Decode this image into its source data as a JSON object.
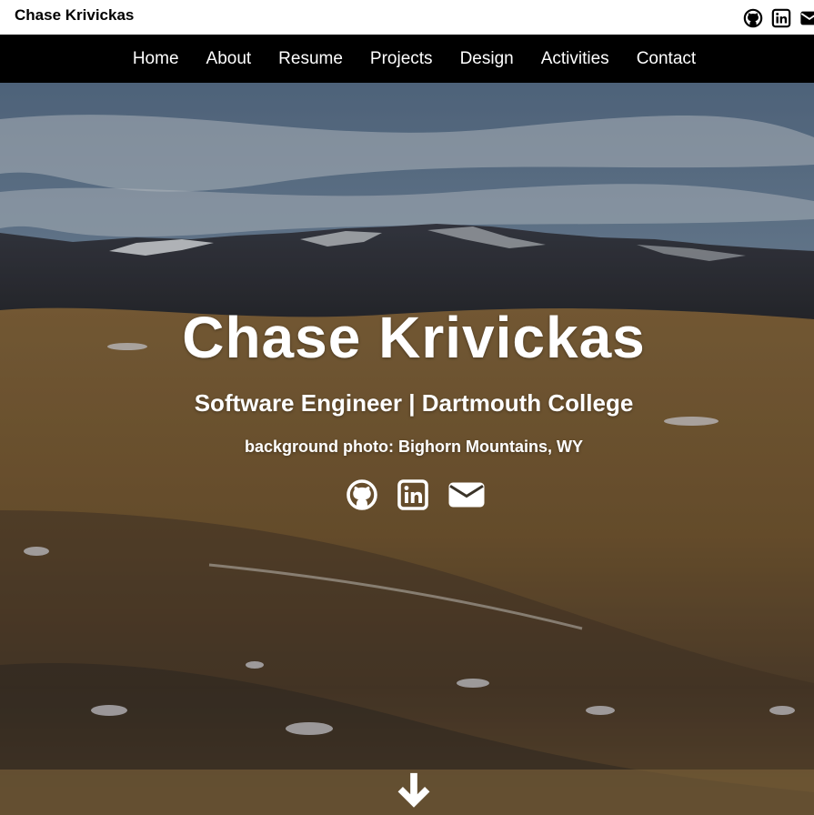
{
  "header": {
    "site_name": "Chase Krivickas",
    "icons": [
      "github-icon",
      "linkedin-icon",
      "mail-icon"
    ]
  },
  "nav": {
    "items": [
      "Home",
      "About",
      "Resume",
      "Projects",
      "Design",
      "Activities",
      "Contact"
    ]
  },
  "hero": {
    "title": "Chase Krivickas",
    "subtitle": "Software Engineer | Dartmouth College",
    "caption": "background photo: Bighorn Mountains, WY",
    "icons": [
      "github-icon",
      "linkedin-icon",
      "mail-icon"
    ],
    "scroll_icon": "arrow-down-icon"
  },
  "colors": {
    "nav_bg": "#000000",
    "text_light": "#ffffff",
    "sky": "#7d93ab",
    "grass": "#8a6a3c"
  }
}
